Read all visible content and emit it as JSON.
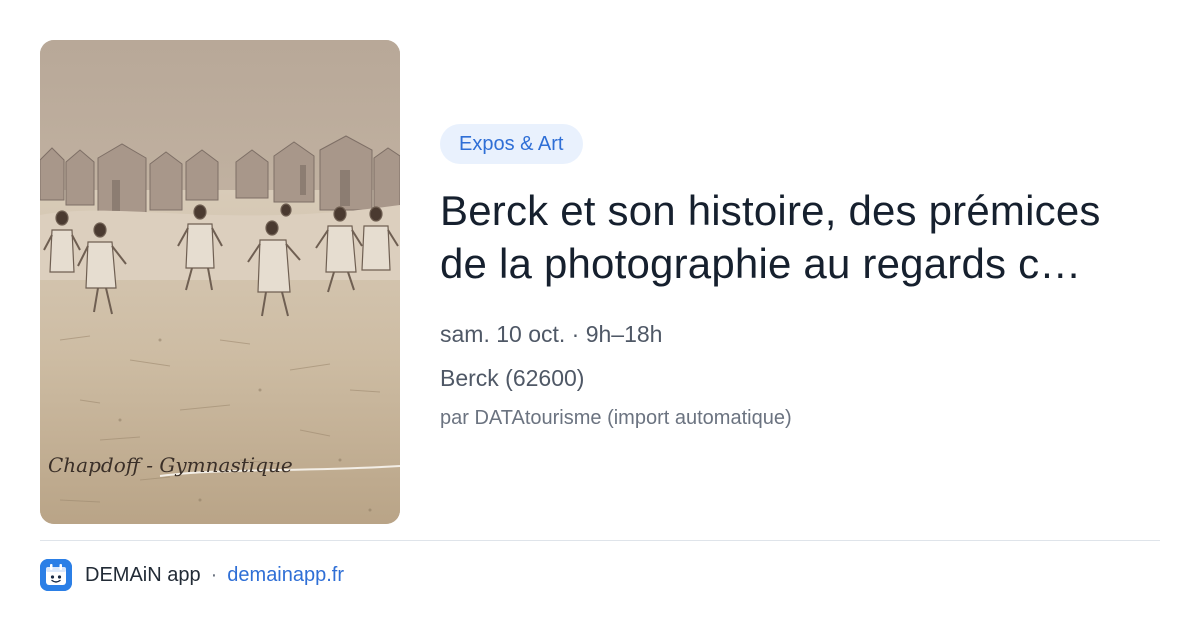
{
  "event": {
    "category": "Expos & Art",
    "title_line1": "Berck et son histoire, des prémices",
    "title_line2": "de la photographie au regards c…",
    "date": "sam. 10 oct. · 9h–18h",
    "place": "Berck (62600)",
    "source": "par DATAtourisme (import automatique)",
    "photo_caption": "Chapdoff - Gymnastique"
  },
  "footer": {
    "app_name": "DEMAiN app",
    "separator": "·",
    "url": "demainapp.fr",
    "icon": "calendar-app-icon"
  },
  "colors": {
    "accent": "#2f6fd6",
    "badge_bg": "#e9f1fd",
    "title": "#16202e",
    "meta": "#4f5866",
    "divider": "#dfe4ea"
  }
}
